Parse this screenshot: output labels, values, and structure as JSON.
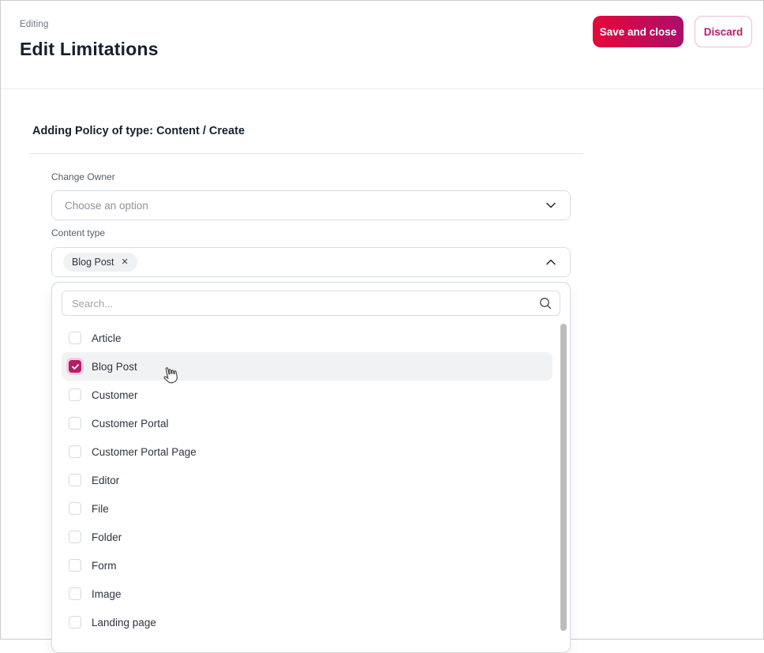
{
  "header": {
    "eyebrow": "Editing",
    "title": "Edit Limitations",
    "save_label": "Save and close",
    "discard_label": "Discard"
  },
  "form": {
    "section_heading": "Adding Policy of type: Content / Create",
    "change_owner": {
      "label": "Change Owner",
      "placeholder": "Choose an option"
    },
    "content_type": {
      "label": "Content type",
      "selected_tag": "Blog Post",
      "remove_icon": "✕"
    }
  },
  "dropdown": {
    "search_placeholder": "Search...",
    "options": [
      {
        "label": "Article",
        "checked": false,
        "highlighted": false
      },
      {
        "label": "Blog Post",
        "checked": true,
        "highlighted": true
      },
      {
        "label": "Customer",
        "checked": false,
        "highlighted": false
      },
      {
        "label": "Customer Portal",
        "checked": false,
        "highlighted": false
      },
      {
        "label": "Customer Portal Page",
        "checked": false,
        "highlighted": false
      },
      {
        "label": "Editor",
        "checked": false,
        "highlighted": false
      },
      {
        "label": "File",
        "checked": false,
        "highlighted": false
      },
      {
        "label": "Folder",
        "checked": false,
        "highlighted": false
      },
      {
        "label": "Form",
        "checked": false,
        "highlighted": false
      },
      {
        "label": "Image",
        "checked": false,
        "highlighted": false
      },
      {
        "label": "Landing page",
        "checked": false,
        "highlighted": false
      }
    ]
  },
  "colors": {
    "accent_gradient_start": "#e4083a",
    "accent_gradient_end": "#ac0e6a",
    "accent_text": "#bc1a68",
    "accent_border": "#eebbd3",
    "checkbox_checked": "#b81d64",
    "checkbox_halo": "#f3cfe0",
    "row_highlight": "#f1f2f3"
  }
}
